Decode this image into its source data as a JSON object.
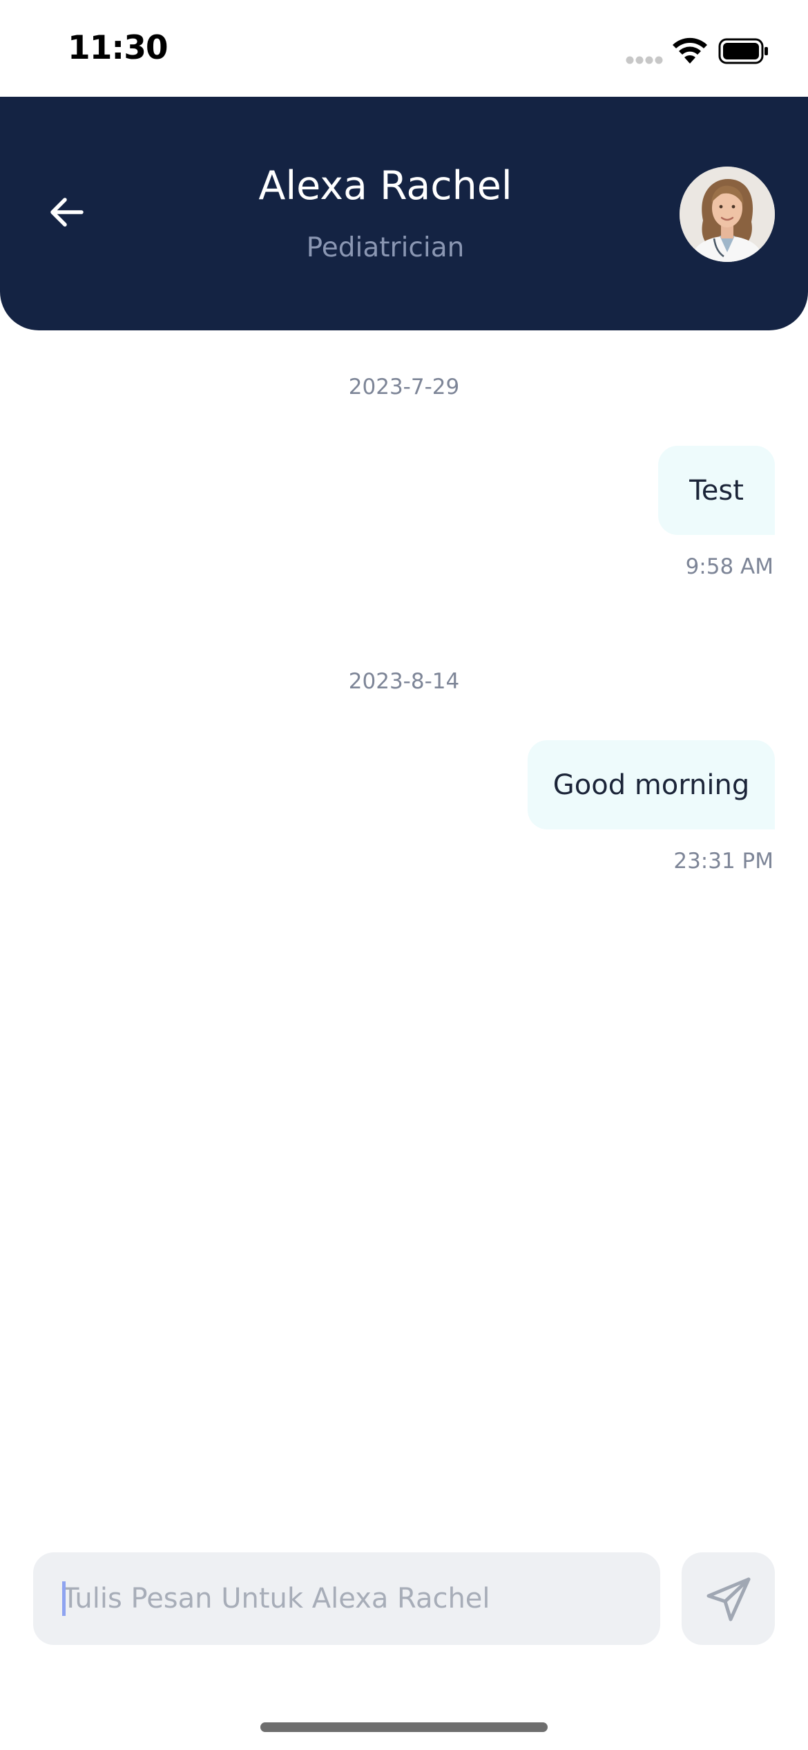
{
  "status_bar": {
    "time": "11:30",
    "icons": [
      "cellular-icon",
      "wifi-icon",
      "battery-icon"
    ]
  },
  "header": {
    "name": "Alexa Rachel",
    "role": "Pediatrician",
    "back_icon": "arrow-left-icon",
    "avatar": "doctor-avatar"
  },
  "chat": {
    "groups": [
      {
        "date": "2023-7-29",
        "messages": [
          {
            "text": "Test",
            "time": "9:58 AM",
            "from": "me"
          }
        ]
      },
      {
        "date": "2023-8-14",
        "messages": [
          {
            "text": "Good morning",
            "time": "23:31 PM",
            "from": "me"
          }
        ]
      }
    ]
  },
  "composer": {
    "placeholder": "Tulis Pesan Untuk Alexa Rachel",
    "value": "",
    "send_icon": "send-icon"
  },
  "colors": {
    "header_bg": "#142343",
    "bubble_bg": "#eefbfc",
    "input_bg": "#eef0f3",
    "muted_text": "#7d8597"
  }
}
